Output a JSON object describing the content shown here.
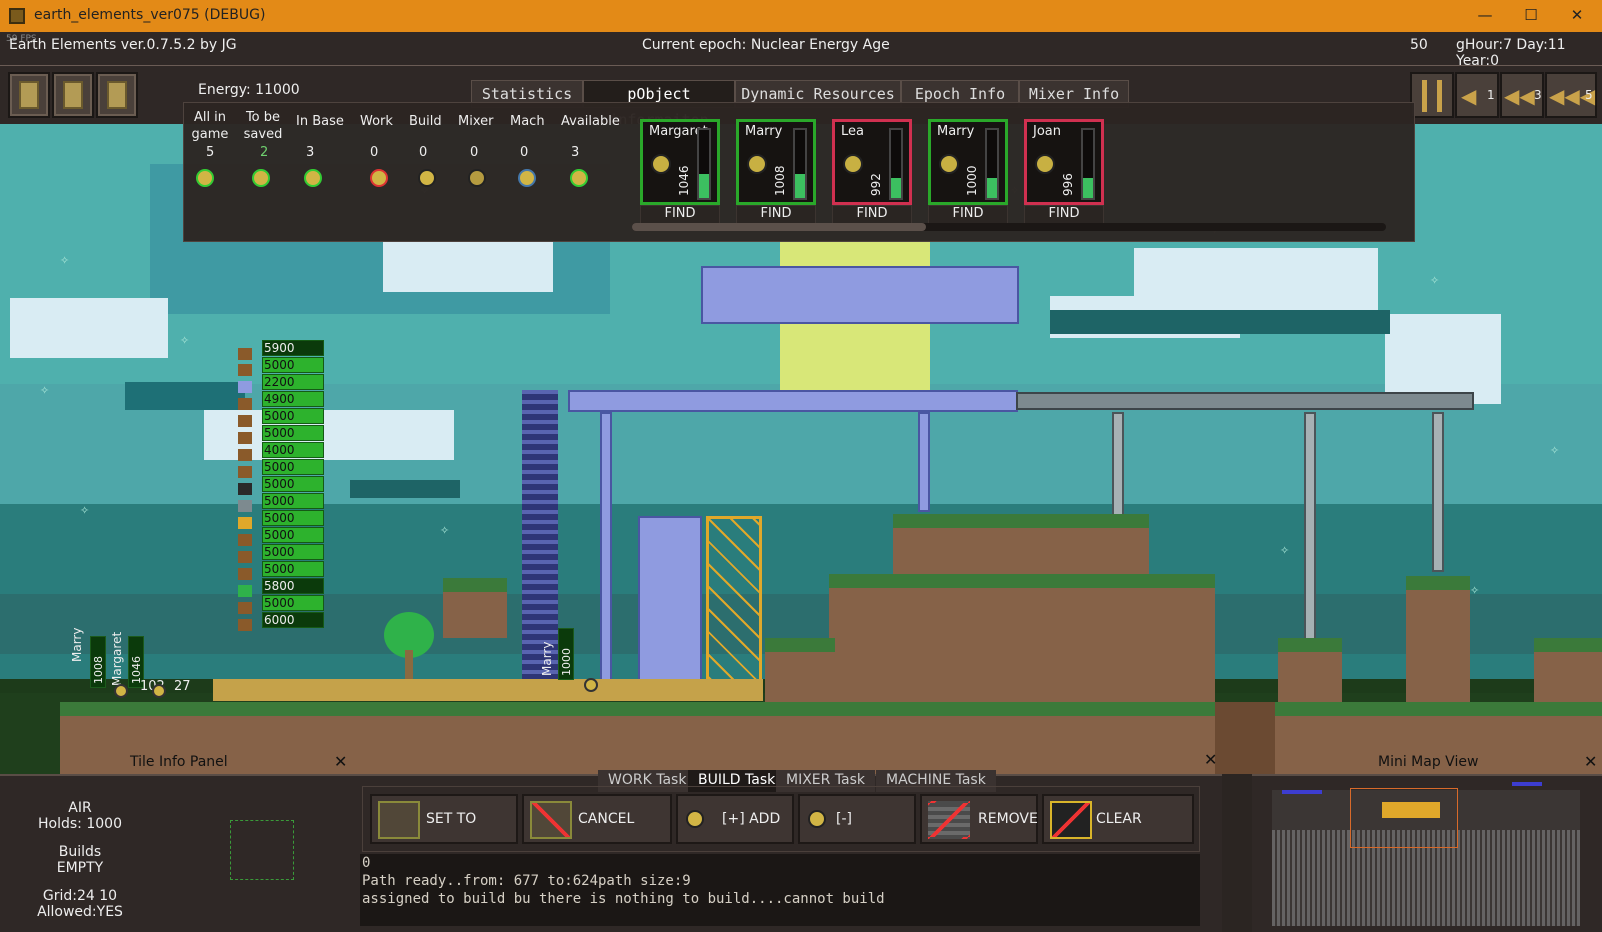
{
  "window": {
    "title": "earth_elements_ver075 (DEBUG)",
    "minimize": "—",
    "maximize": "☐",
    "close": "✕"
  },
  "hud": {
    "version": "Earth Elements ver.0.7.5.2 by JG",
    "epoch": "Current epoch: Nuclear Energy Age",
    "speed": "50",
    "time": "gHour:7 Day:11 Year:0",
    "fps": "59 FPS"
  },
  "energy": "Energy:  11000",
  "tabs": [
    "Statistics",
    "pObject informaiton",
    "Dynamic Resources",
    "Epoch Info",
    "Mixer Info"
  ],
  "speed_buttons": [
    "1",
    "3",
    "5"
  ],
  "stats": {
    "headers": [
      "All in game",
      "To be saved",
      "In Base",
      "Work",
      "Build",
      "Mixer",
      "Mach",
      "Available"
    ],
    "values": [
      "5",
      "2",
      "3",
      "0",
      "0",
      "0",
      "0",
      "3"
    ]
  },
  "humans": [
    {
      "name": "Margaret",
      "value": "1046",
      "health": 0.35,
      "border": "#2aa82a"
    },
    {
      "name": "Marry",
      "value": "1008",
      "health": 0.35,
      "border": "#2aa82a"
    },
    {
      "name": "Lea",
      "value": "992",
      "health": 0.3,
      "border": "#d03050"
    },
    {
      "name": "Marry",
      "value": "1000",
      "health": 0.3,
      "border": "#2aa82a"
    },
    {
      "name": "Joan",
      "value": "996",
      "health": 0.3,
      "border": "#d03050"
    }
  ],
  "find_label": "FIND",
  "resources": [
    "5900",
    "5000",
    "2200",
    "4900",
    "5000",
    "5000",
    "4000",
    "5000",
    "5000",
    "5000",
    "5000",
    "5000",
    "5000",
    "5000",
    "5800",
    "5000",
    "6000"
  ],
  "map_labels": {
    "a": "Marry",
    "b": "1008",
    "c": "Margaret",
    "d": "1046",
    "e": "102",
    "f": "27",
    "g": "Marry",
    "h": "1000"
  },
  "tile_panel": {
    "title": "Tile Info Panel",
    "type": "AIR",
    "holds": "Holds: 1000",
    "builds": "Builds",
    "builds_val": "EMPTY",
    "grid": "Grid:24 10",
    "allowed": "Allowed:YES",
    "close": "✕"
  },
  "build_panel": {
    "tabs": [
      "WORK Task",
      "BUILD Task",
      "MIXER Task",
      "MACHINE Task"
    ],
    "buttons": [
      "SET TO BUILD",
      "CANCEL BUILD",
      "[+] ADD",
      "[-] RELEASE",
      "REMOVE",
      "CLEAR CURSOR"
    ],
    "close": "✕"
  },
  "log": [
    "0",
    "Path ready..from: 677 to:624path  size:9",
    "assigned to build bu there is nothing to build....cannot build"
  ],
  "minimap": {
    "title": "Mini Map View",
    "close": "✕"
  }
}
